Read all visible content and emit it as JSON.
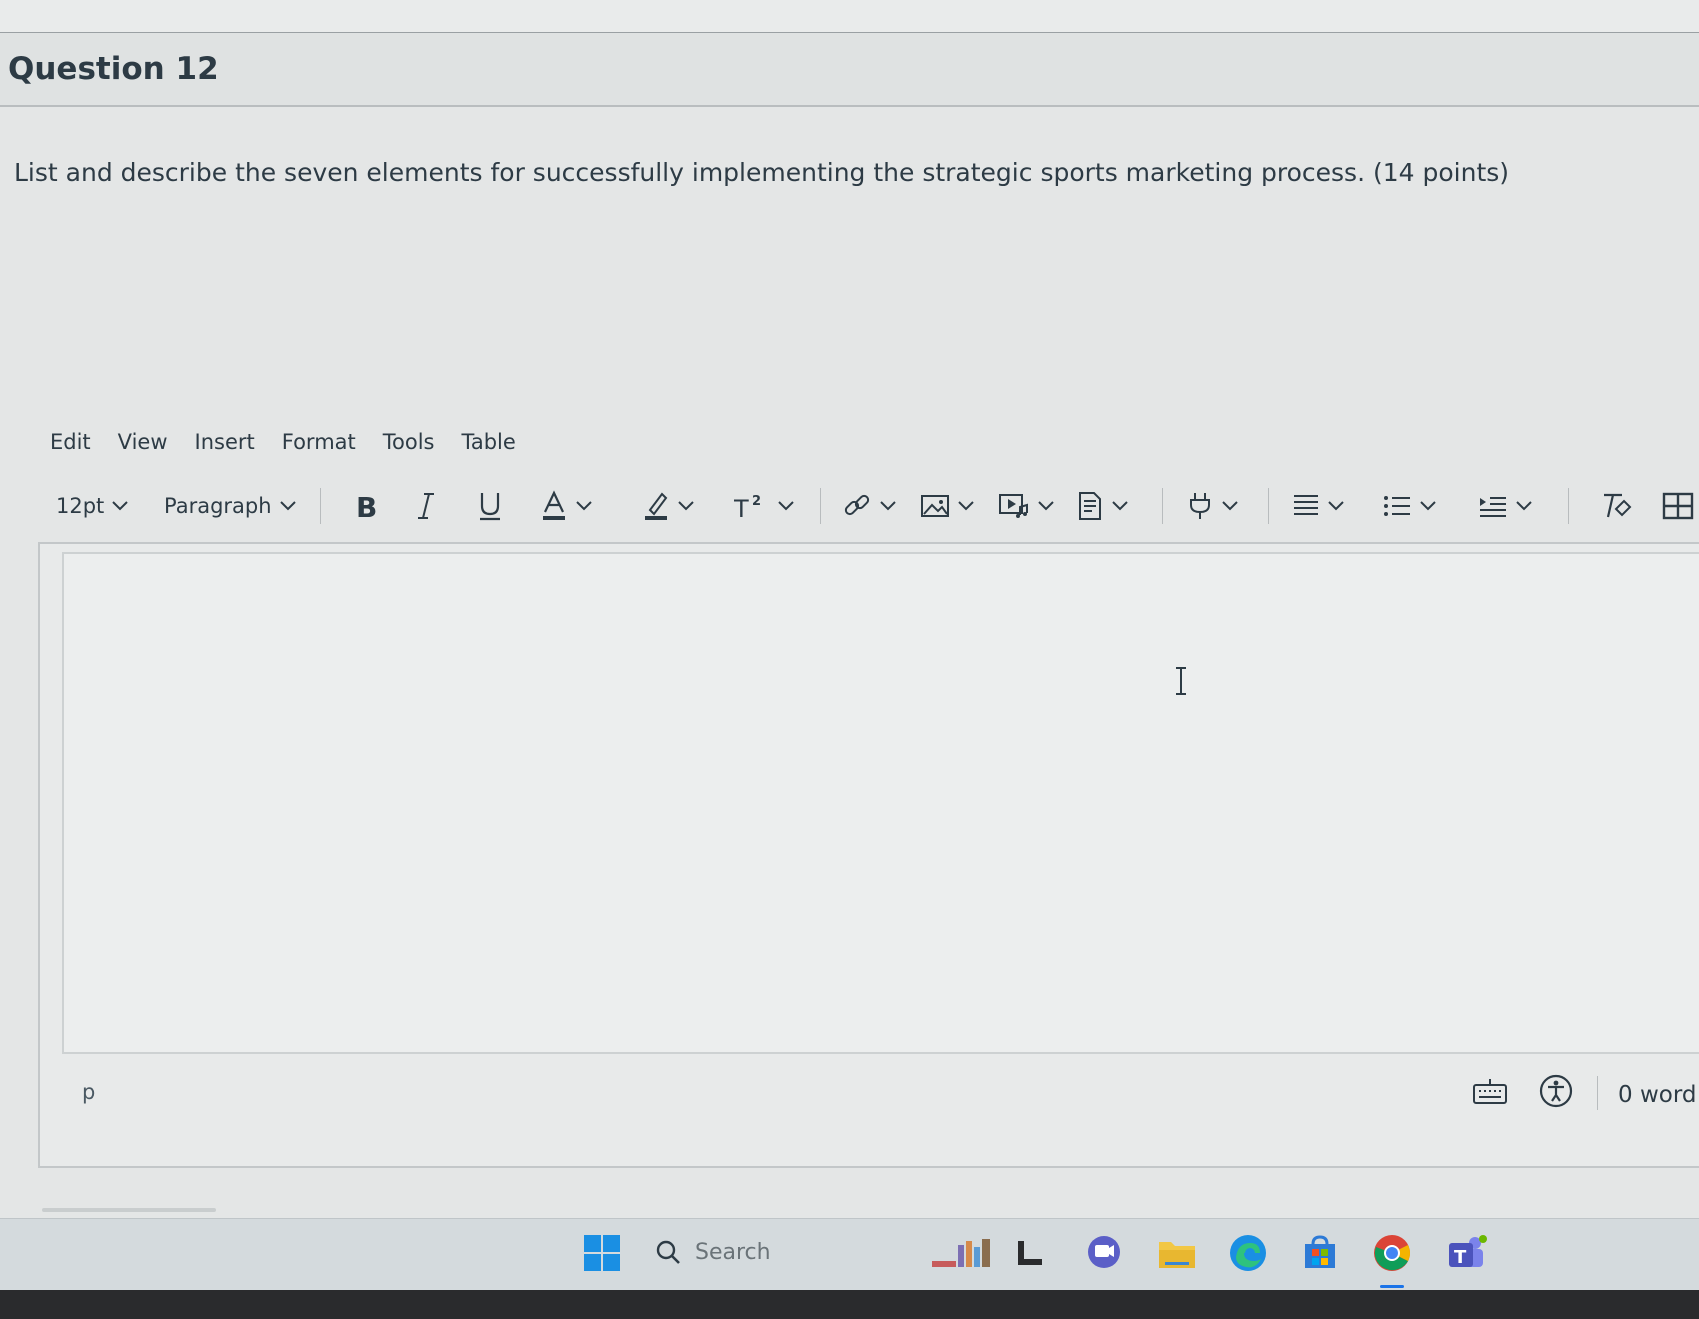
{
  "question": {
    "title": "Question 12",
    "prompt": "List and describe the seven elements for successfully implementing the strategic sports marketing process. (14 points)"
  },
  "menubar": [
    "Edit",
    "View",
    "Insert",
    "Format",
    "Tools",
    "Table"
  ],
  "toolbar": {
    "font_size": "12pt",
    "block_format": "Paragraph",
    "icons": [
      "bold-icon",
      "italic-icon",
      "underline-icon",
      "text-color-icon",
      "highlight-icon",
      "superscript-icon",
      "link-icon",
      "image-icon",
      "media-icon",
      "document-icon",
      "plugin-icon",
      "align-icon",
      "bullet-list-icon",
      "indent-icon",
      "clear-formatting-icon",
      "table-icon"
    ]
  },
  "status_bar": {
    "element_path": "p",
    "word_count": "0 word"
  },
  "taskbar": {
    "search_placeholder": "Search",
    "apps": [
      "start-icon",
      "search-icon",
      "widgets-icon",
      "explorer-pane-icon",
      "chat-icon",
      "file-explorer-icon",
      "edge-icon",
      "store-icon",
      "chrome-icon",
      "teams-icon"
    ]
  },
  "colors": {
    "text": "#2d3b45",
    "background": "#e4e6e6",
    "taskbar": "#d4dadd",
    "windows_blue": "#1a8fe3"
  }
}
